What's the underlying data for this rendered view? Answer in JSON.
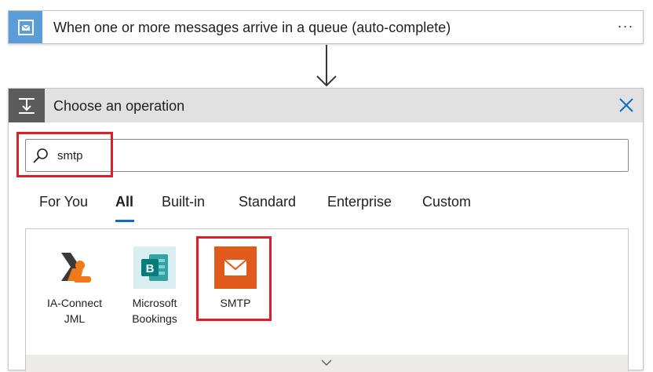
{
  "trigger": {
    "title": "When one or more messages arrive in a queue (auto-complete)",
    "more_label": "···",
    "icon": "service-bus-envelope-icon",
    "icon_bg": "#5a9dd8"
  },
  "operation_panel": {
    "title": "Choose an operation",
    "icon": "operation-step-icon",
    "header_bg": "#e1e1e1",
    "close_icon": "close-icon"
  },
  "search": {
    "value": "smtp",
    "icon": "search-icon"
  },
  "tabs": [
    {
      "label": "For You",
      "active": false
    },
    {
      "label": "All",
      "active": true
    },
    {
      "label": "Built-in",
      "active": false
    },
    {
      "label": "Standard",
      "active": false
    },
    {
      "label": "Enterprise",
      "active": false
    },
    {
      "label": "Custom",
      "active": false
    }
  ],
  "connectors": [
    {
      "label_line1": "IA-Connect",
      "label_line2": "JML",
      "icon": "ia-connect-icon"
    },
    {
      "label_line1": "Microsoft",
      "label_line2": "Bookings",
      "icon": "microsoft-bookings-icon",
      "color": "#037c7e"
    },
    {
      "label_line1": "SMTP",
      "label_line2": "",
      "icon": "smtp-envelope-icon",
      "color": "#e05a1b"
    }
  ],
  "colors": {
    "accent": "#0f6cbd",
    "highlight": "#e01e2b"
  }
}
